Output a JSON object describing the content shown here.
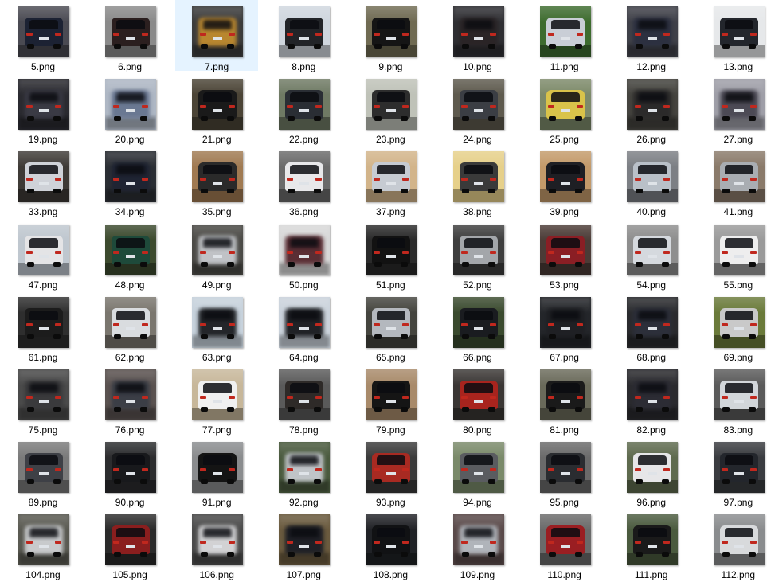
{
  "colors": {
    "background": "#ffffff",
    "selection": "#e5f3ff",
    "label_text": "#000000"
  },
  "selected_file": "7.png",
  "files": [
    {
      "name": "5.png",
      "car": "#1c2233",
      "bg": "#4a4a52",
      "blur": false
    },
    {
      "name": "6.png",
      "car": "#2b1f1f",
      "bg": "#8a8a8a",
      "blur": false
    },
    {
      "name": "7.png",
      "car": "#b8862f",
      "bg": "#3b3b3b",
      "blur": true
    },
    {
      "name": "8.png",
      "car": "#222428",
      "bg": "#cfd6de",
      "blur": false
    },
    {
      "name": "9.png",
      "car": "#151515",
      "bg": "#6f6a52",
      "blur": false
    },
    {
      "name": "10.png",
      "car": "#2a2426",
      "bg": "#2f2f33",
      "blur": true
    },
    {
      "name": "11.png",
      "car": "#c9ced6",
      "bg": "#3d6b2e",
      "blur": false
    },
    {
      "name": "12.png",
      "car": "#2c3040",
      "bg": "#3f4048",
      "blur": true
    },
    {
      "name": "13.png",
      "car": "#23262c",
      "bg": "#e6e8ea",
      "blur": false
    },
    {
      "name": "19.png",
      "car": "#3a3a44",
      "bg": "#2a2a30",
      "blur": true
    },
    {
      "name": "20.png",
      "car": "#6a7892",
      "bg": "#aeb7c4",
      "blur": true
    },
    {
      "name": "21.png",
      "car": "#1a1a1a",
      "bg": "#4b4436",
      "blur": false
    },
    {
      "name": "22.png",
      "car": "#2a2e34",
      "bg": "#6f7a64",
      "blur": false
    },
    {
      "name": "23.png",
      "car": "#2d2d2d",
      "bg": "#bfc2b8",
      "blur": false
    },
    {
      "name": "24.png",
      "car": "#3b3e44",
      "bg": "#5e5a4e",
      "blur": false
    },
    {
      "name": "25.png",
      "car": "#d9c34a",
      "bg": "#7d8a6a",
      "blur": false
    },
    {
      "name": "26.png",
      "car": "#2b2a2a",
      "bg": "#44433e",
      "blur": true
    },
    {
      "name": "27.png",
      "car": "#4c4a55",
      "bg": "#9f9fa8",
      "blur": true
    },
    {
      "name": "33.png",
      "car": "#cfd2d8",
      "bg": "#3e3a36",
      "blur": false
    },
    {
      "name": "34.png",
      "car": "#1f2433",
      "bg": "#2b2e34",
      "blur": true
    },
    {
      "name": "35.png",
      "car": "#2a2a2a",
      "bg": "#a07a52",
      "blur": false
    },
    {
      "name": "36.png",
      "car": "#e8e8ea",
      "bg": "#6a6a6a",
      "blur": false
    },
    {
      "name": "37.png",
      "car": "#c6cbd2",
      "bg": "#d2b48a",
      "blur": false
    },
    {
      "name": "38.png",
      "car": "#3a3a3a",
      "bg": "#e6d08a",
      "blur": false
    },
    {
      "name": "39.png",
      "car": "#1e1f24",
      "bg": "#c39a6a",
      "blur": false
    },
    {
      "name": "40.png",
      "car": "#b9c0c8",
      "bg": "#7c7f84",
      "blur": false
    },
    {
      "name": "41.png",
      "car": "#a9adb2",
      "bg": "#8a7a6a",
      "blur": false
    },
    {
      "name": "47.png",
      "car": "#e4e4e6",
      "bg": "#bfc7cf",
      "blur": false
    },
    {
      "name": "48.png",
      "car": "#1e4a3a",
      "bg": "#3c4a2e",
      "blur": false
    },
    {
      "name": "49.png",
      "car": "#c0c2c6",
      "bg": "#4b4a46",
      "blur": true
    },
    {
      "name": "50.png",
      "car": "#5a2e34",
      "bg": "#d8d8d8",
      "blur": true
    },
    {
      "name": "51.png",
      "car": "#121212",
      "bg": "#2a2a2a",
      "blur": false
    },
    {
      "name": "52.png",
      "car": "#a3a6aa",
      "bg": "#3e3e3e",
      "blur": false
    },
    {
      "name": "53.png",
      "car": "#8a1e24",
      "bg": "#4b3b36",
      "blur": false
    },
    {
      "name": "54.png",
      "car": "#d5d9de",
      "bg": "#8e8e8e",
      "blur": false
    },
    {
      "name": "55.png",
      "car": "#eeeeee",
      "bg": "#9a9a9a",
      "blur": false
    },
    {
      "name": "61.png",
      "car": "#1c1c1c",
      "bg": "#2e2e2e",
      "blur": false
    },
    {
      "name": "62.png",
      "car": "#d9dcdf",
      "bg": "#7a766e",
      "blur": false
    },
    {
      "name": "63.png",
      "car": "#24262a",
      "bg": "#c7d2dc",
      "blur": true
    },
    {
      "name": "64.png",
      "car": "#202226",
      "bg": "#cbd3dc",
      "blur": true
    },
    {
      "name": "65.png",
      "car": "#b4b8be",
      "bg": "#44443e",
      "blur": false
    },
    {
      "name": "66.png",
      "car": "#1a1c20",
      "bg": "#3a4a2e",
      "blur": false
    },
    {
      "name": "67.png",
      "car": "#1f2024",
      "bg": "#24262a",
      "blur": true
    },
    {
      "name": "68.png",
      "car": "#2c2f3a",
      "bg": "#2a2b2e",
      "blur": true
    },
    {
      "name": "69.png",
      "car": "#c9c9c9",
      "bg": "#6a7a3a",
      "blur": false
    },
    {
      "name": "75.png",
      "car": "#3a3a3c",
      "bg": "#4a4a4a",
      "blur": true
    },
    {
      "name": "76.png",
      "car": "#3b3e46",
      "bg": "#5a5250",
      "blur": true
    },
    {
      "name": "77.png",
      "car": "#f0f0f0",
      "bg": "#c7b79a",
      "blur": false
    },
    {
      "name": "78.png",
      "car": "#2e2a28",
      "bg": "#5a5a5a",
      "blur": false
    },
    {
      "name": "79.png",
      "car": "#151515",
      "bg": "#a88a6a",
      "blur": false
    },
    {
      "name": "80.png",
      "car": "#a8241e",
      "bg": "#3a3634",
      "blur": false
    },
    {
      "name": "81.png",
      "car": "#1a1a1a",
      "bg": "#6a6a5a",
      "blur": false
    },
    {
      "name": "82.png",
      "car": "#2c2c34",
      "bg": "#2a2a2e",
      "blur": true
    },
    {
      "name": "83.png",
      "car": "#d2d6da",
      "bg": "#5a5a5a",
      "blur": false
    },
    {
      "name": "89.png",
      "car": "#3e4046",
      "bg": "#7a7a7a",
      "blur": false
    },
    {
      "name": "90.png",
      "car": "#18191c",
      "bg": "#2b2c2e",
      "blur": false
    },
    {
      "name": "91.png",
      "car": "#141414",
      "bg": "#8a8c8e",
      "blur": false
    },
    {
      "name": "92.png",
      "car": "#c0c4c8",
      "bg": "#4a5a3e",
      "blur": true
    },
    {
      "name": "93.png",
      "car": "#a82a22",
      "bg": "#3a3a3a",
      "blur": false
    },
    {
      "name": "94.png",
      "car": "#5a5c60",
      "bg": "#7a8a6a",
      "blur": false
    },
    {
      "name": "95.png",
      "car": "#2a2c30",
      "bg": "#6a6a6a",
      "blur": false
    },
    {
      "name": "96.png",
      "car": "#e6e6e8",
      "bg": "#5e6a4e",
      "blur": false
    },
    {
      "name": "97.png",
      "car": "#23262c",
      "bg": "#3a3c40",
      "blur": false
    },
    {
      "name": "104.png",
      "car": "#c8cacc",
      "bg": "#5a5a52",
      "blur": true
    },
    {
      "name": "105.png",
      "car": "#8a1e1e",
      "bg": "#2a2a2a",
      "blur": false
    },
    {
      "name": "106.png",
      "car": "#d2d2d4",
      "bg": "#4a4a4a",
      "blur": true
    },
    {
      "name": "107.png",
      "car": "#1f2026",
      "bg": "#6a5a3e",
      "blur": true
    },
    {
      "name": "108.png",
      "car": "#111214",
      "bg": "#202226",
      "blur": false
    },
    {
      "name": "109.png",
      "car": "#b0b4ba",
      "bg": "#5a4a4a",
      "blur": true
    },
    {
      "name": "110.png",
      "car": "#9a1e22",
      "bg": "#6a6a6a",
      "blur": false
    },
    {
      "name": "111.png",
      "car": "#1a1a1a",
      "bg": "#4a5a3e",
      "blur": false
    },
    {
      "name": "112.png",
      "car": "#d8dadc",
      "bg": "#8a8c8e",
      "blur": false
    }
  ]
}
